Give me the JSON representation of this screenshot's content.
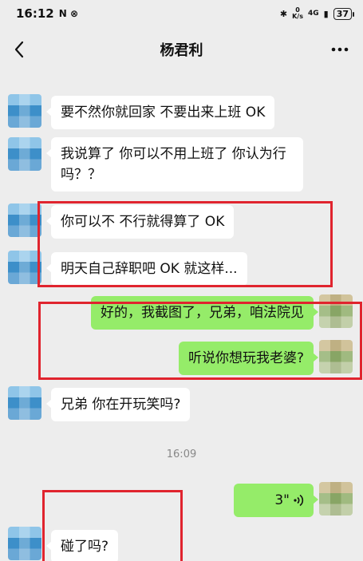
{
  "status_bar": {
    "time": "16:12",
    "notif_icons": "N ⊗",
    "speed_value": "0",
    "speed_unit": "K/s",
    "network": "4G",
    "battery": "37",
    "bluetooth": "✱",
    "signal": "▮"
  },
  "nav": {
    "title": "杨君利",
    "back_icon": "chevron-left-icon",
    "more_icon": "more-dots-icon"
  },
  "messages": [
    {
      "side": "in",
      "text": "要不然你就回家 不要出来上班 OK"
    },
    {
      "side": "in",
      "text": "我说算了 你可以不用上班了 你认为行吗？？"
    },
    {
      "side": "in",
      "text": "你可以不 不行就得算了 OK"
    },
    {
      "side": "in",
      "text": "明天自己辞职吧 OK 就这样..."
    },
    {
      "side": "out",
      "text": "好的，我截图了，兄弟，咱法院见"
    },
    {
      "side": "out",
      "text": "听说你想玩我老婆?"
    },
    {
      "side": "in",
      "text": "兄弟 你在开玩笑吗?"
    },
    {
      "side": "out",
      "type": "voice",
      "duration": "3\""
    },
    {
      "side": "in",
      "text": "碰了吗?"
    }
  ],
  "timestamp": "16:09",
  "colors": {
    "background": "#ededed",
    "incoming_bubble": "#ffffff",
    "outgoing_bubble": "#95ec69",
    "highlight": "#e0242e"
  }
}
